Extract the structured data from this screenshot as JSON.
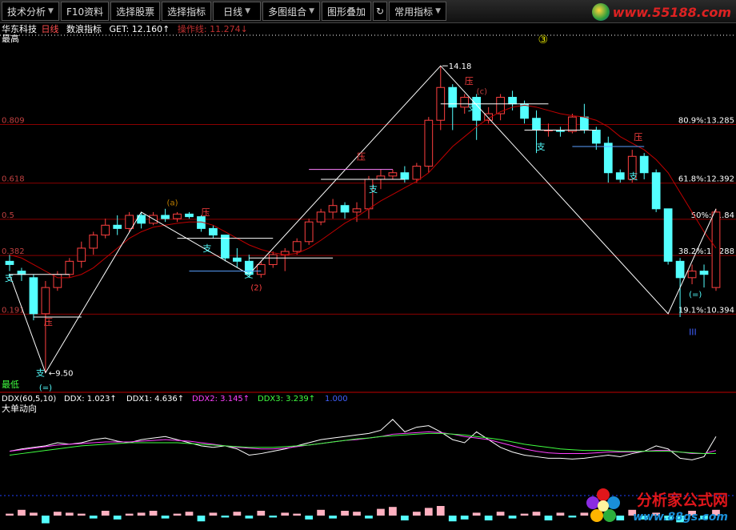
{
  "toolbar": {
    "buttons": [
      "技术分析",
      "F10资料",
      "选择股票",
      "选择指标",
      "日线",
      "多图组合",
      "图形叠加",
      "常用指标"
    ],
    "refresh_icon": "refresh-icon"
  },
  "logo": {
    "text": "www.55188.com"
  },
  "info": {
    "stock": "华东科技",
    "period": "日线",
    "indicator": "数浪指标",
    "get": "GET: 12.160↑",
    "ctl": "操作线: 11.274↓"
  },
  "price_panel": {
    "label_high": "最高",
    "label_low": "最低",
    "left_axis": [
      "0.809",
      "0.618",
      "0.5",
      "0.382",
      "0.191"
    ],
    "fib_labels": [
      "80.9%:13.285",
      "61.8%:12.392",
      "50%:11.84",
      "38.2%:11.288",
      "19.1%:10.394"
    ],
    "annotations": {
      "peak": "14.18",
      "low": "9.50",
      "wave3": "③",
      "wave2": "(2)",
      "zhi": "支",
      "ya": "压",
      "er": "(=)",
      "three": "III",
      "wave_c": "(c)",
      "wave_a": "(a)"
    }
  },
  "ddx_panel": {
    "header": "DDX(60,5,10)",
    "ddx": "DDX: 1.023↑",
    "ddx1": "DDX1: 4.636↑",
    "ddx2": "DDX2: 3.145↑",
    "ddx3": "DDX3: 3.239↑",
    "ddx4": "1.000",
    "subtitle": "大单动向"
  },
  "watermark": {
    "title": "分析家公式网",
    "url": "www.88gs.com"
  },
  "colors": {
    "up": "#ff4040",
    "down": "#54ffff",
    "ma": "#c00000",
    "ddx_white": "#ffffff",
    "ddx_magenta": "#ff40ff",
    "ddx_green": "#40ff40",
    "grid_red": "#8b0000",
    "fib": "#ffffff"
  },
  "chart_data": {
    "type": "candlestick",
    "y_range": [
      9.3,
      14.5
    ],
    "candles": [
      {
        "o": 11.2,
        "h": 11.3,
        "l": 11.05,
        "c": 11.15
      },
      {
        "o": 11.05,
        "h": 11.1,
        "l": 10.9,
        "c": 11.0
      },
      {
        "o": 10.95,
        "h": 11.0,
        "l": 10.3,
        "c": 10.4
      },
      {
        "o": 10.4,
        "h": 10.9,
        "l": 9.5,
        "c": 10.8
      },
      {
        "o": 10.8,
        "h": 11.05,
        "l": 10.75,
        "c": 11.0
      },
      {
        "o": 11.0,
        "h": 11.25,
        "l": 10.95,
        "c": 11.2
      },
      {
        "o": 11.2,
        "h": 11.5,
        "l": 11.1,
        "c": 11.4
      },
      {
        "o": 11.4,
        "h": 11.65,
        "l": 11.3,
        "c": 11.6
      },
      {
        "o": 11.6,
        "h": 11.85,
        "l": 11.55,
        "c": 11.75
      },
      {
        "o": 11.75,
        "h": 11.9,
        "l": 11.6,
        "c": 11.7
      },
      {
        "o": 11.7,
        "h": 11.95,
        "l": 11.65,
        "c": 11.9
      },
      {
        "o": 11.9,
        "h": 11.95,
        "l": 11.7,
        "c": 11.78
      },
      {
        "o": 11.78,
        "h": 11.95,
        "l": 11.75,
        "c": 11.9
      },
      {
        "o": 11.9,
        "h": 12.0,
        "l": 11.8,
        "c": 11.85
      },
      {
        "o": 11.85,
        "h": 11.95,
        "l": 11.8,
        "c": 11.92
      },
      {
        "o": 11.92,
        "h": 11.95,
        "l": 11.85,
        "c": 11.88
      },
      {
        "o": 11.88,
        "h": 11.9,
        "l": 11.65,
        "c": 11.7
      },
      {
        "o": 11.7,
        "h": 11.75,
        "l": 11.55,
        "c": 11.6
      },
      {
        "o": 11.6,
        "h": 11.6,
        "l": 11.2,
        "c": 11.25
      },
      {
        "o": 11.25,
        "h": 11.4,
        "l": 11.1,
        "c": 11.2
      },
      {
        "o": 11.2,
        "h": 11.3,
        "l": 10.95,
        "c": 11.0
      },
      {
        "o": 11.0,
        "h": 11.2,
        "l": 10.95,
        "c": 11.15
      },
      {
        "o": 11.15,
        "h": 11.35,
        "l": 11.1,
        "c": 11.3
      },
      {
        "o": 11.3,
        "h": 11.4,
        "l": 11.05,
        "c": 11.35
      },
      {
        "o": 11.35,
        "h": 11.55,
        "l": 11.3,
        "c": 11.5
      },
      {
        "o": 11.5,
        "h": 11.85,
        "l": 11.45,
        "c": 11.8
      },
      {
        "o": 11.8,
        "h": 12.0,
        "l": 11.75,
        "c": 11.95
      },
      {
        "o": 11.95,
        "h": 12.15,
        "l": 11.85,
        "c": 12.05
      },
      {
        "o": 12.05,
        "h": 12.1,
        "l": 11.85,
        "c": 11.95
      },
      {
        "o": 11.95,
        "h": 12.1,
        "l": 11.8,
        "c": 12.0
      },
      {
        "o": 12.0,
        "h": 12.5,
        "l": 11.85,
        "c": 12.45
      },
      {
        "o": 12.45,
        "h": 12.6,
        "l": 12.3,
        "c": 12.5
      },
      {
        "o": 12.5,
        "h": 12.6,
        "l": 12.45,
        "c": 12.55
      },
      {
        "o": 12.55,
        "h": 12.65,
        "l": 12.4,
        "c": 12.45
      },
      {
        "o": 12.45,
        "h": 12.7,
        "l": 12.4,
        "c": 12.65
      },
      {
        "o": 12.65,
        "h": 13.4,
        "l": 12.55,
        "c": 13.35
      },
      {
        "o": 13.35,
        "h": 14.18,
        "l": 13.2,
        "c": 13.85
      },
      {
        "o": 13.85,
        "h": 13.9,
        "l": 13.2,
        "c": 13.55
      },
      {
        "o": 13.55,
        "h": 13.75,
        "l": 13.45,
        "c": 13.7
      },
      {
        "o": 13.7,
        "h": 13.75,
        "l": 13.05,
        "c": 13.35
      },
      {
        "o": 13.35,
        "h": 13.55,
        "l": 13.3,
        "c": 13.45
      },
      {
        "o": 13.45,
        "h": 13.75,
        "l": 13.35,
        "c": 13.7
      },
      {
        "o": 13.7,
        "h": 13.8,
        "l": 13.5,
        "c": 13.6
      },
      {
        "o": 13.6,
        "h": 13.65,
        "l": 13.3,
        "c": 13.38
      },
      {
        "o": 13.38,
        "h": 13.5,
        "l": 12.85,
        "c": 13.2
      },
      {
        "o": 13.2,
        "h": 13.3,
        "l": 13.1,
        "c": 13.2
      },
      {
        "o": 13.2,
        "h": 13.25,
        "l": 13.1,
        "c": 13.18
      },
      {
        "o": 13.18,
        "h": 13.45,
        "l": 13.15,
        "c": 13.4
      },
      {
        "o": 13.4,
        "h": 13.6,
        "l": 13.15,
        "c": 13.2
      },
      {
        "o": 13.2,
        "h": 13.25,
        "l": 12.9,
        "c": 13.0
      },
      {
        "o": 13.0,
        "h": 13.1,
        "l": 12.4,
        "c": 12.55
      },
      {
        "o": 12.55,
        "h": 12.6,
        "l": 12.4,
        "c": 12.45
      },
      {
        "o": 12.45,
        "h": 12.9,
        "l": 12.4,
        "c": 12.8
      },
      {
        "o": 12.8,
        "h": 12.85,
        "l": 12.45,
        "c": 12.55
      },
      {
        "o": 12.55,
        "h": 12.6,
        "l": 11.95,
        "c": 12.0
      },
      {
        "o": 12.0,
        "h": 12.0,
        "l": 11.15,
        "c": 11.2
      },
      {
        "o": 11.2,
        "h": 11.25,
        "l": 10.35,
        "c": 10.95
      },
      {
        "o": 10.95,
        "h": 11.15,
        "l": 10.85,
        "c": 11.05
      },
      {
        "o": 11.05,
        "h": 11.15,
        "l": 10.8,
        "c": 11.0
      },
      {
        "o": 10.8,
        "h": 12.0,
        "l": 10.75,
        "c": 11.95
      }
    ],
    "ma": [
      11.3,
      11.25,
      11.15,
      11.05,
      10.95,
      10.95,
      11.0,
      11.1,
      11.25,
      11.4,
      11.55,
      11.65,
      11.72,
      11.75,
      11.78,
      11.8,
      11.8,
      11.75,
      11.65,
      11.55,
      11.45,
      11.38,
      11.33,
      11.3,
      11.32,
      11.4,
      11.52,
      11.65,
      11.78,
      11.88,
      12.0,
      12.12,
      12.22,
      12.32,
      12.42,
      12.55,
      12.75,
      12.95,
      13.1,
      13.25,
      13.38,
      13.48,
      13.55,
      13.58,
      13.55,
      13.5,
      13.45,
      13.42,
      13.4,
      13.35,
      13.25,
      13.1,
      13.0,
      12.9,
      12.75,
      12.55,
      12.25,
      11.95,
      11.65,
      11.4
    ],
    "zigzag": [
      [
        0,
        11.0
      ],
      [
        3,
        9.5
      ],
      [
        11,
        11.95
      ],
      [
        20,
        11.0
      ],
      [
        36,
        14.18
      ],
      [
        55,
        10.4
      ],
      [
        59,
        12.0
      ]
    ],
    "ddx": {
      "white": [
        0.55,
        0.58,
        0.6,
        0.62,
        0.66,
        0.64,
        0.66,
        0.7,
        0.72,
        0.68,
        0.66,
        0.7,
        0.72,
        0.74,
        0.7,
        0.66,
        0.62,
        0.6,
        0.62,
        0.58,
        0.5,
        0.52,
        0.55,
        0.58,
        0.62,
        0.66,
        0.7,
        0.72,
        0.74,
        0.76,
        0.78,
        0.82,
        0.96,
        0.8,
        0.86,
        0.88,
        0.8,
        0.7,
        0.66,
        0.8,
        0.7,
        0.6,
        0.54,
        0.5,
        0.48,
        0.46,
        0.46,
        0.45,
        0.46,
        0.48,
        0.5,
        0.48,
        0.52,
        0.55,
        0.62,
        0.58,
        0.46,
        0.44,
        0.48,
        0.74
      ],
      "magenta": [
        0.55,
        0.57,
        0.59,
        0.61,
        0.63,
        0.64,
        0.65,
        0.66,
        0.67,
        0.67,
        0.67,
        0.68,
        0.69,
        0.7,
        0.69,
        0.68,
        0.66,
        0.64,
        0.62,
        0.6,
        0.59,
        0.58,
        0.58,
        0.59,
        0.61,
        0.63,
        0.65,
        0.67,
        0.69,
        0.7,
        0.72,
        0.74,
        0.77,
        0.78,
        0.79,
        0.8,
        0.79,
        0.77,
        0.74,
        0.72,
        0.7,
        0.66,
        0.62,
        0.58,
        0.55,
        0.53,
        0.52,
        0.52,
        0.52,
        0.53,
        0.54,
        0.54,
        0.54,
        0.55,
        0.56,
        0.56,
        0.54,
        0.52,
        0.52,
        0.56
      ],
      "green": [
        0.5,
        0.52,
        0.54,
        0.56,
        0.58,
        0.6,
        0.62,
        0.63,
        0.64,
        0.65,
        0.66,
        0.66,
        0.66,
        0.66,
        0.66,
        0.65,
        0.64,
        0.63,
        0.62,
        0.61,
        0.6,
        0.6,
        0.6,
        0.61,
        0.62,
        0.63,
        0.65,
        0.67,
        0.69,
        0.71,
        0.72,
        0.74,
        0.75,
        0.76,
        0.77,
        0.78,
        0.78,
        0.77,
        0.76,
        0.74,
        0.72,
        0.7,
        0.67,
        0.64,
        0.62,
        0.6,
        0.58,
        0.57,
        0.56,
        0.56,
        0.56,
        0.55,
        0.55,
        0.55,
        0.55,
        0.55,
        0.54,
        0.53,
        0.52,
        0.52
      ],
      "bars": [
        0.2,
        0.6,
        0.3,
        0.8,
        0.4,
        0.3,
        0.2,
        0.3,
        0.5,
        0.4,
        0.2,
        0.3,
        0.5,
        0.3,
        0.2,
        0.4,
        0.6,
        0.3,
        0.2,
        0.4,
        0.3,
        0.5,
        0.2,
        0.3,
        0.2,
        0.4,
        0.6,
        0.3,
        0.5,
        0.4,
        0.3,
        0.7,
        0.9,
        0.5,
        0.4,
        0.8,
        1.0,
        0.6,
        0.4,
        0.3,
        0.5,
        0.4,
        0.3,
        0.2,
        0.4,
        0.5,
        0.3,
        0.2,
        0.3,
        0.4,
        0.3,
        0.5,
        0.6,
        0.4,
        0.3,
        0.5,
        0.7,
        0.5,
        0.4,
        0.6
      ],
      "bar_sign": [
        1,
        1,
        1,
        -1,
        1,
        1,
        1,
        -1,
        1,
        -1,
        1,
        1,
        1,
        -1,
        1,
        1,
        -1,
        1,
        -1,
        1,
        -1,
        1,
        -1,
        1,
        1,
        -1,
        1,
        -1,
        1,
        1,
        -1,
        1,
        1,
        -1,
        1,
        1,
        1,
        -1,
        -1,
        1,
        -1,
        1,
        -1,
        1,
        1,
        -1,
        1,
        -1,
        1,
        1,
        -1,
        -1,
        1,
        -1,
        1,
        -1,
        -1,
        1,
        -1,
        1
      ]
    }
  }
}
